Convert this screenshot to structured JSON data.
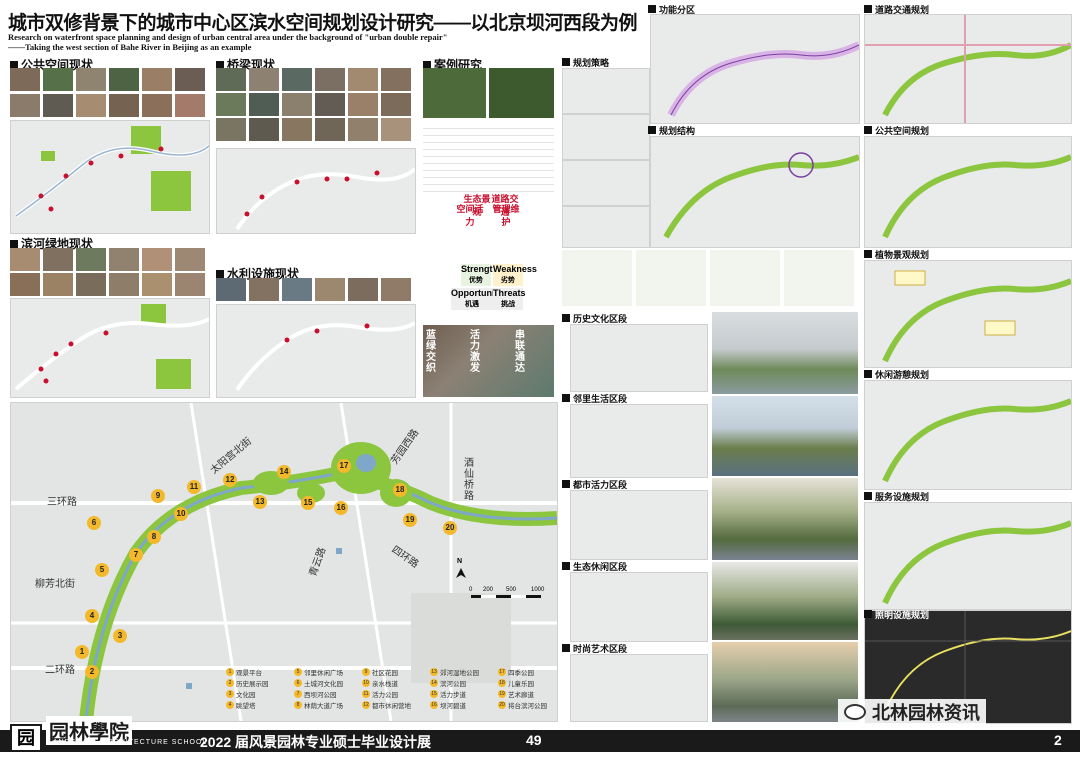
{
  "title_cn": "城市双修背景下的城市中心区滨水空间规划设计研究——以北京坝河西段为例",
  "title_en_1": "Research on waterfront space planning and design of urban central area under the background of \"urban double repair\"",
  "title_en_2": "——Taking the west section of Bahe River in Beijing as an example",
  "sections": {
    "public_space_status": "公共空间现状",
    "bridge_status": "桥梁现状",
    "case_study": "案例研究",
    "planning_strategy": "规划策略",
    "function_zone": "功能分区",
    "road_traffic": "道路交通规划",
    "riverside_green_status": "滨河绿地现状",
    "water_facility_status": "水利设施现状",
    "planning_structure": "规划结构",
    "public_space_planning": "公共空间规划",
    "plant_landscape": "植物景观规划",
    "history_culture": "历史文化区段",
    "neighborhood_life": "邻里生活区段",
    "urban_vitality": "都市活力区段",
    "eco_leisure": "生态休闲区段",
    "fashion_art": "时尚艺术区段",
    "leisure_tour": "休闲游憩规划",
    "service_facility": "服务设施规划",
    "lighting_facility": "照明设施规划"
  },
  "swot": {
    "strength_cn": "优势",
    "strength_en": "Strength",
    "weakness_cn": "劣势",
    "weakness_en": "Weakness",
    "opportunities_cn": "机遇",
    "opportunities_en": "Opportunities",
    "threats_cn": "挑战",
    "threats_en": "Threats",
    "s1": "空间活力",
    "s2": "管理维护",
    "s3": "生态景观",
    "s4": "道路交通"
  },
  "strategy_words": {
    "w1": "蓝绿交织",
    "w2": "活力激发",
    "w3": "串联通达"
  },
  "map_labels": {
    "sanhuan": "三环路",
    "erhuan": "二环路",
    "liufang": "柳芳北街",
    "taiyanggong": "太阳宫北街",
    "fangyuan": "芳园西路",
    "jiuxianqiao": "酒仙桥路",
    "qingyun": "青云路",
    "sihuan": "四环路",
    "scale_0": "0",
    "scale_1": "200",
    "scale_2": "500",
    "scale_3": "1000",
    "north": "N"
  },
  "numbers": [
    "1",
    "2",
    "3",
    "4",
    "5",
    "6",
    "7",
    "8",
    "9",
    "10",
    "11",
    "12",
    "13",
    "14",
    "15",
    "16",
    "17",
    "18",
    "19",
    "20"
  ],
  "legend": [
    {
      "n": "1",
      "t": "观景平台"
    },
    {
      "n": "2",
      "t": "历史展示园"
    },
    {
      "n": "3",
      "t": "文化园"
    },
    {
      "n": "4",
      "t": "眺望塔"
    },
    {
      "n": "5",
      "t": "邻里休闲广场"
    },
    {
      "n": "6",
      "t": "土城河文化园"
    },
    {
      "n": "7",
      "t": "西坝河公园"
    },
    {
      "n": "8",
      "t": "林荫大道广场"
    },
    {
      "n": "9",
      "t": "社区花园"
    },
    {
      "n": "10",
      "t": "亲水栈道"
    },
    {
      "n": "11",
      "t": "活力公园"
    },
    {
      "n": "12",
      "t": "都市休闲营地"
    },
    {
      "n": "13",
      "t": "郊河湿地公园"
    },
    {
      "n": "14",
      "t": "滨河公园"
    },
    {
      "n": "15",
      "t": "活力步道"
    },
    {
      "n": "16",
      "t": "坝河碧道"
    },
    {
      "n": "17",
      "t": "四季公园"
    },
    {
      "n": "18",
      "t": "儿童乐园"
    },
    {
      "n": "19",
      "t": "艺术廊道"
    },
    {
      "n": "20",
      "t": "将台滨河公园"
    }
  ],
  "footer": {
    "school_cn": "园林學院",
    "school_en": "LANDSCAPE ARCHITECTURE SCHOOL",
    "exhibition": "2022 届风景园林专业硕士毕业设计展",
    "exhibition_num": "49",
    "page_num": "2",
    "watermark": "北林园林资讯"
  },
  "colors": {
    "green": "#8cc63f",
    "map_bg": "#e9eaea",
    "footer_bg": "#1a1a1a",
    "dot_red": "#c8102e",
    "badge": "#f3b92b",
    "purple": "#7a3fa0"
  }
}
